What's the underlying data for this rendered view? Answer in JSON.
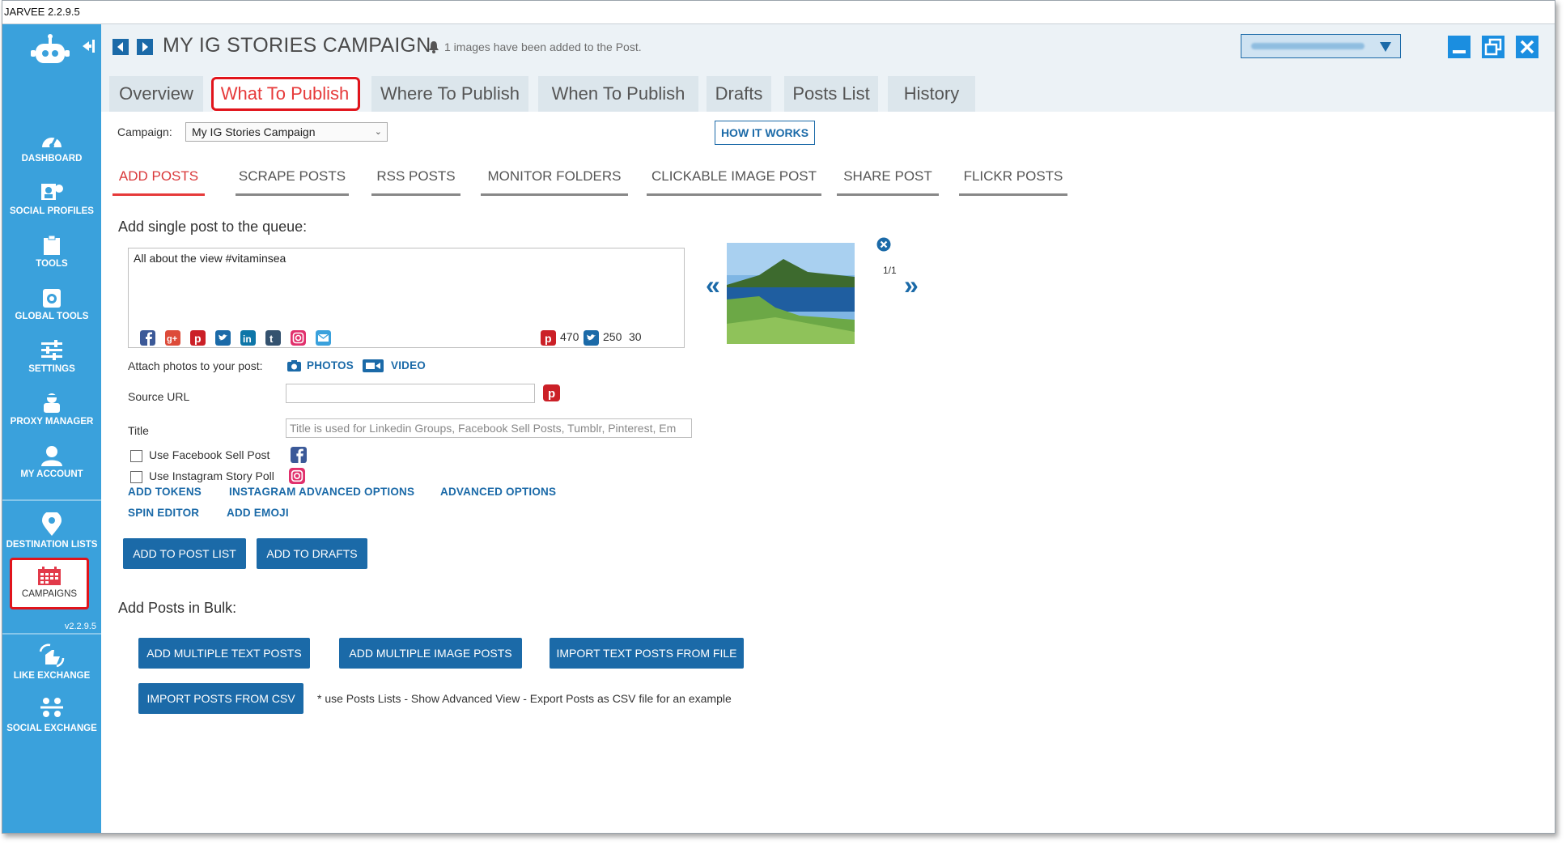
{
  "app": {
    "window_title": "JARVEE 2.2.9.5",
    "version_label": "v2.2.9.5"
  },
  "sidebar": {
    "items": [
      {
        "label": "DASHBOARD",
        "icon": "dashboard-icon"
      },
      {
        "label": "SOCIAL PROFILES",
        "icon": "social-profiles-icon"
      },
      {
        "label": "TOOLS",
        "icon": "tools-icon"
      },
      {
        "label": "GLOBAL TOOLS",
        "icon": "global-tools-icon"
      },
      {
        "label": "SETTINGS",
        "icon": "settings-icon"
      },
      {
        "label": "PROXY MANAGER",
        "icon": "proxy-manager-icon"
      },
      {
        "label": "MY ACCOUNT",
        "icon": "my-account-icon"
      },
      {
        "label": "DESTINATION LISTS",
        "icon": "destination-lists-icon"
      },
      {
        "label": "CAMPAIGNS",
        "icon": "campaigns-icon"
      },
      {
        "label": "LIKE EXCHANGE",
        "icon": "like-exchange-icon"
      },
      {
        "label": "SOCIAL EXCHANGE",
        "icon": "social-exchange-icon"
      }
    ]
  },
  "header": {
    "title": "MY IG STORIES CAMPAIGN",
    "notification": "1 images have been added to the Post."
  },
  "tabs": [
    {
      "label": "Overview"
    },
    {
      "label": "What To Publish",
      "active": true
    },
    {
      "label": "Where To Publish"
    },
    {
      "label": "When To Publish"
    },
    {
      "label": "Drafts"
    },
    {
      "label": "Posts List"
    },
    {
      "label": "History"
    }
  ],
  "campaign": {
    "label": "Campaign:",
    "selected": "My IG Stories Campaign",
    "how_it_works": "HOW IT WORKS"
  },
  "subtabs": [
    {
      "label": "ADD POSTS",
      "active": true
    },
    {
      "label": "SCRAPE POSTS"
    },
    {
      "label": "RSS POSTS"
    },
    {
      "label": "MONITOR FOLDERS"
    },
    {
      "label": "CLICKABLE IMAGE POST"
    },
    {
      "label": "SHARE POST"
    },
    {
      "label": "FLICKR POSTS"
    }
  ],
  "single_post": {
    "heading": "Add single post to the queue:",
    "text": "All about the view #vitaminsea",
    "social_icons": [
      "facebook-icon",
      "google-plus-icon",
      "pinterest-icon",
      "twitter-icon",
      "linkedin-icon",
      "tumblr-icon",
      "instagram-icon",
      "email-icon"
    ],
    "counters": {
      "pinterest": "470",
      "twitter": "250",
      "other": "30"
    },
    "attach_label": "Attach photos to your post:",
    "photos_label": "PHOTOS",
    "video_label": "VIDEO",
    "source_url_label": "Source URL",
    "source_url_value": "",
    "title_label": "Title",
    "title_placeholder": "Title is used for Linkedin Groups, Facebook Sell Posts, Tumblr, Pinterest, Em",
    "fb_sell_label": "Use Facebook Sell Post",
    "ig_poll_label": "Use Instagram Story Poll",
    "links": {
      "add_tokens": "ADD TOKENS",
      "instagram_advanced": "INSTAGRAM ADVANCED OPTIONS",
      "advanced": "ADVANCED OPTIONS",
      "spin_editor": "SPIN EDITOR",
      "add_emoji": "ADD EMOJI"
    },
    "add_to_post_list": "ADD TO POST LIST",
    "add_to_drafts": "ADD TO DRAFTS",
    "image_pager": "1/1"
  },
  "bulk": {
    "heading": "Add Posts in Bulk:",
    "add_multiple_text": "ADD MULTIPLE TEXT POSTS",
    "add_multiple_image": "ADD MULTIPLE IMAGE POSTS",
    "import_text_file": "IMPORT TEXT POSTS FROM FILE",
    "import_csv": "IMPORT POSTS FROM CSV",
    "csv_note": "* use Posts Lists - Show Advanced View - Export Posts as CSV file for an example"
  },
  "colors": {
    "sidebar": "#3aa1dc",
    "accent": "#1b6aa8",
    "active_tab": "#e63a3a",
    "highlight": "#e1141b"
  }
}
